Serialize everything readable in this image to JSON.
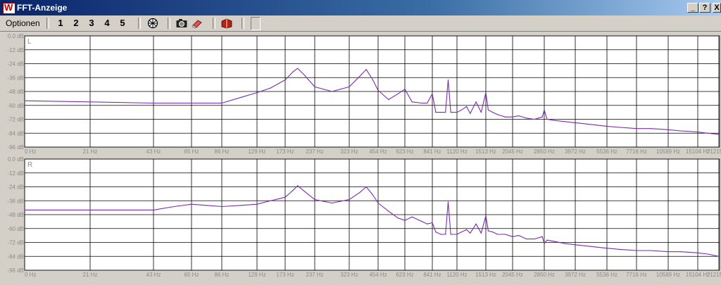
{
  "window": {
    "title": "FFT-Anzeige",
    "app_icon_letter": "W",
    "buttons": {
      "minimize": "_",
      "help": "?",
      "close": "X"
    }
  },
  "toolbar": {
    "menu_label": "Optionen",
    "channel_buttons": [
      "1",
      "2",
      "3",
      "4",
      "5"
    ]
  },
  "colors": {
    "trace": "#7b2cb0",
    "grid": "#000000",
    "plot_bg": "#ffffff",
    "label": "#8a8a8a"
  },
  "chart_data": [
    {
      "type": "line",
      "channel_label": "L",
      "scale": "log-frequency",
      "ylim": [
        -96,
        0
      ],
      "y_ticks": [
        "0.0 dB",
        "-12 dB",
        "-24 dB",
        "-36 dB",
        "-48 dB",
        "-60 dB",
        "-72 dB",
        "-84 dB",
        "-96 dB"
      ],
      "x_ticks": [
        "0 Hz",
        "21 Hz",
        "43 Hz",
        "65 Hz",
        "86 Hz",
        "129 Hz",
        "173 Hz",
        "237 Hz",
        "323 Hz",
        "454 Hz",
        "623 Hz",
        "841 Hz",
        "1120 Hz",
        "1513 Hz",
        "2045 Hz",
        "2850 Hz",
        "3972 Hz",
        "5536 Hz",
        "7716 Hz",
        "10589 Hz",
        "15104 Hz",
        "21215 Hz"
      ],
      "series": [
        {
          "x": [
            0,
            21,
            43,
            65,
            86,
            110,
            129,
            150,
            173,
            190,
            200,
            215,
            237,
            280,
            323,
            370,
            400,
            430,
            454,
            520,
            580,
            623,
            680,
            760,
            800,
            841,
            880,
            940,
            990,
            1020,
            1050,
            1120,
            1180,
            1250,
            1300,
            1380,
            1450,
            1513,
            1560,
            1650,
            1750,
            1900,
            2045,
            2200,
            2400,
            2600,
            2800,
            2850,
            2950,
            3200,
            3600,
            3972,
            4500,
            5000,
            5536,
            6500,
            7716,
            9000,
            10589,
            12500,
            15104,
            18000,
            21215
          ],
          "y": [
            -56,
            -57,
            -58,
            -58,
            -58,
            -53,
            -49,
            -45,
            -38,
            -31,
            -28,
            -34,
            -44,
            -48,
            -44,
            -35,
            -29,
            -38,
            -47,
            -55,
            -50,
            -46,
            -57,
            -58,
            -58,
            -50,
            -66,
            -66,
            -66,
            -38,
            -66,
            -66,
            -64,
            -61,
            -67,
            -57,
            -66,
            -49,
            -64,
            -66,
            -68,
            -70,
            -70,
            -69,
            -71,
            -72,
            -70,
            -64,
            -72,
            -73,
            -74,
            -75,
            -76,
            -77,
            -78,
            -79,
            -80,
            -80,
            -81,
            -82,
            -83,
            -84,
            -85
          ]
        }
      ]
    },
    {
      "type": "line",
      "channel_label": "R",
      "scale": "log-frequency",
      "ylim": [
        -96,
        0
      ],
      "y_ticks": [
        "0.0 dB",
        "-12 dB",
        "-24 dB",
        "-36 dB",
        "-48 dB",
        "-60 dB",
        "-72 dB",
        "-84 dB",
        "-96 dB"
      ],
      "x_ticks": [
        "0 Hz",
        "21 Hz",
        "43 Hz",
        "65 Hz",
        "86 Hz",
        "129 Hz",
        "173 Hz",
        "237 Hz",
        "323 Hz",
        "454 Hz",
        "623 Hz",
        "841 Hz",
        "1120 Hz",
        "1513 Hz",
        "2045 Hz",
        "2850 Hz",
        "3972 Hz",
        "5536 Hz",
        "7716 Hz",
        "10589 Hz",
        "15104 Hz",
        "21215 Hz"
      ],
      "series": [
        {
          "x": [
            0,
            21,
            43,
            55,
            65,
            75,
            86,
            110,
            129,
            150,
            173,
            190,
            200,
            215,
            237,
            280,
            323,
            370,
            400,
            430,
            454,
            520,
            580,
            623,
            680,
            760,
            800,
            841,
            880,
            940,
            990,
            1020,
            1050,
            1120,
            1180,
            1250,
            1300,
            1380,
            1450,
            1513,
            1560,
            1650,
            1750,
            1900,
            2045,
            2200,
            2400,
            2600,
            2800,
            2850,
            2950,
            3200,
            3600,
            3972,
            4500,
            5000,
            5536,
            6500,
            7716,
            9000,
            10589,
            12500,
            15104,
            18000,
            21215
          ],
          "y": [
            -44,
            -44,
            -44,
            -41,
            -39,
            -40,
            -41,
            -40,
            -39,
            -36,
            -33,
            -27,
            -23,
            -28,
            -35,
            -38,
            -35,
            -29,
            -24,
            -31,
            -38,
            -45,
            -51,
            -53,
            -50,
            -54,
            -56,
            -55,
            -63,
            -65,
            -65,
            -37,
            -65,
            -65,
            -63,
            -61,
            -64,
            -56,
            -64,
            -49,
            -62,
            -63,
            -65,
            -65,
            -67,
            -66,
            -69,
            -69,
            -67,
            -73,
            -70,
            -71,
            -73,
            -74,
            -75,
            -76,
            -77,
            -78,
            -79,
            -79,
            -80,
            -80,
            -81,
            -82,
            -84
          ]
        }
      ]
    }
  ]
}
